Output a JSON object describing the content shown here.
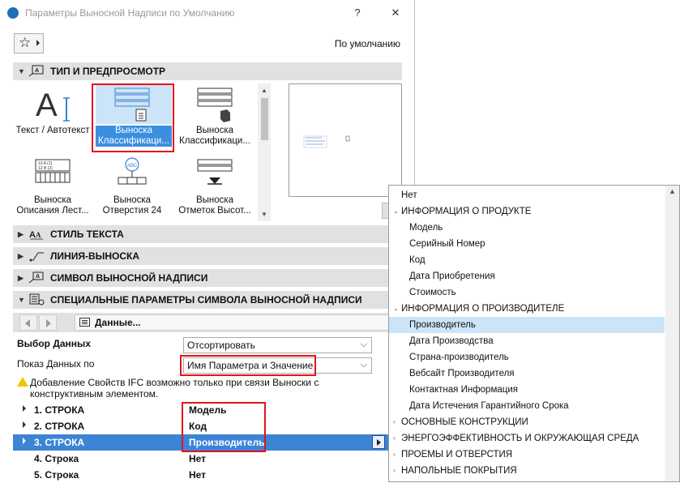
{
  "window": {
    "title": "Параметры Выносной Надписи по Умолчанию",
    "help_label": "?",
    "close_label": "✕"
  },
  "favorites": {
    "default_label": "По умолчанию"
  },
  "sections": [
    {
      "label": "ТИП И ПРЕДПРОСМОТР",
      "expanded": true
    },
    {
      "label": "СТИЛЬ ТЕКСТА",
      "expanded": false
    },
    {
      "label": "ЛИНИЯ-ВЫНОСКА",
      "expanded": false
    },
    {
      "label": "СИМВОЛ ВЫНОСНОЙ НАДПИСИ",
      "expanded": false
    },
    {
      "label": "СПЕЦИАЛЬНЫЕ ПАРАМЕТРЫ СИМВОЛА ВЫНОСНОЙ НАДПИСИ",
      "expanded": true
    }
  ],
  "gallery": {
    "items": [
      {
        "line1": "Текст / Автотекст",
        "line2": ""
      },
      {
        "line1": "Выноска",
        "line2": "Классификаци..."
      },
      {
        "line1": "Выноска",
        "line2": "Классификаци..."
      },
      {
        "line1": "Выноска",
        "line2": "Описания Лест..."
      },
      {
        "line1": "Выноска",
        "line2": "Отверстия 24"
      },
      {
        "line1": "Выноска",
        "line2": "Отметок Высот..."
      }
    ],
    "selected_index": 1,
    "icon_labels": [
      "13 A (1)",
      "12 B (2)",
      "ABC"
    ]
  },
  "special": {
    "data_button_label": "Данные...",
    "data_select_label": "Выбор Данных",
    "data_select_value": "Отсортировать",
    "show_by_label": "Показ Данных по",
    "show_by_value": "Имя Параметра и Значение",
    "warning": "Добавление Свойств IFC возможно только при связи Выноски с конструктивным элементом."
  },
  "rows": [
    {
      "name": "1. СТРОКА",
      "value": "Модель",
      "expandable": true
    },
    {
      "name": "2. СТРОКА",
      "value": "Код",
      "expandable": true
    },
    {
      "name": "3. СТРОКА",
      "value": "Производитель",
      "expandable": true,
      "selected": true
    },
    {
      "name": "4. Строка",
      "value": "Нет",
      "expandable": false
    },
    {
      "name": "5. Строка",
      "value": "Нет",
      "expandable": false
    }
  ],
  "popup": {
    "items": [
      {
        "label": "Нет",
        "type": "item",
        "level": 0
      },
      {
        "label": "ИНФОРМАЦИЯ О ПРОДУКТЕ",
        "type": "group",
        "expanded": true
      },
      {
        "label": "Модель",
        "type": "item",
        "level": 1
      },
      {
        "label": "Серийный Номер",
        "type": "item",
        "level": 1
      },
      {
        "label": "Код",
        "type": "item",
        "level": 1
      },
      {
        "label": "Дата Приобретения",
        "type": "item",
        "level": 1
      },
      {
        "label": "Стоимость",
        "type": "item",
        "level": 1
      },
      {
        "label": "ИНФОРМАЦИЯ О ПРОИЗВОДИТЕЛЕ",
        "type": "group",
        "expanded": true
      },
      {
        "label": "Производитель",
        "type": "item",
        "level": 1,
        "highlighted": true
      },
      {
        "label": "Дата Производства",
        "type": "item",
        "level": 1
      },
      {
        "label": "Страна-производитель",
        "type": "item",
        "level": 1
      },
      {
        "label": "Вебсайт Производителя",
        "type": "item",
        "level": 1
      },
      {
        "label": "Контактная Информация",
        "type": "item",
        "level": 1
      },
      {
        "label": "Дата Истечения Гарантийного Срока",
        "type": "item",
        "level": 1
      },
      {
        "label": "ОСНОВНЫЕ КОНСТРУКЦИИ",
        "type": "group",
        "expanded": false
      },
      {
        "label": "ЭНЕРГОЭФФЕКТИВНОСТЬ И ОКРУЖАЮЩАЯ СРЕДА",
        "type": "group",
        "expanded": false
      },
      {
        "label": "ПРОЕМЫ И ОТВЕРСТИЯ",
        "type": "group",
        "expanded": false
      },
      {
        "label": "НАПОЛЬНЫЕ ПОКРЫТИЯ",
        "type": "group",
        "expanded": false
      }
    ]
  },
  "colors": {
    "highlight_box": "#e6131a",
    "selected_row": "#3c84d6",
    "popup_highlight": "#cce4f7"
  }
}
